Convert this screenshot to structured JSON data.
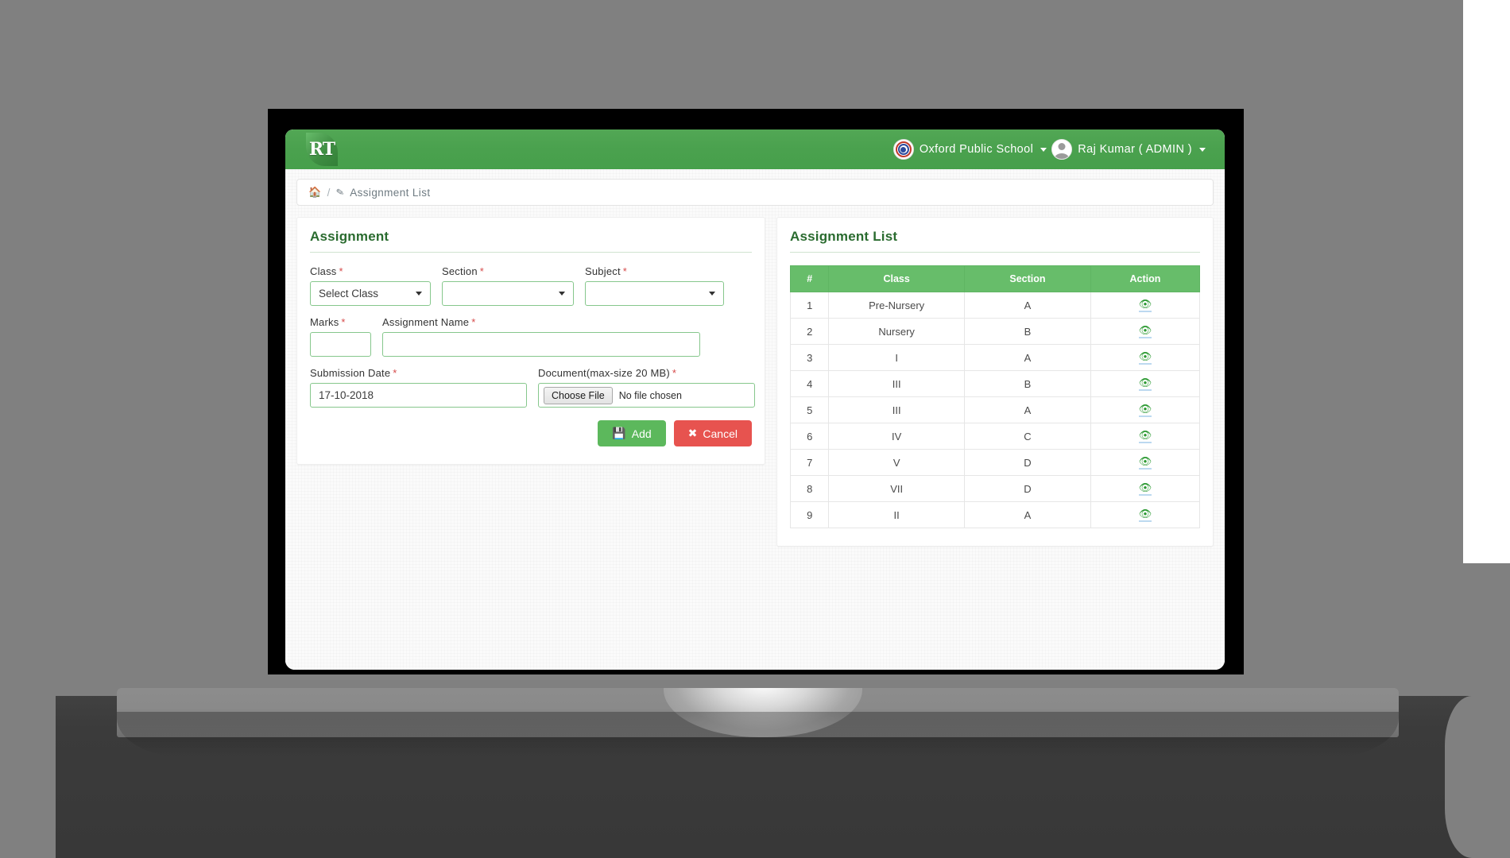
{
  "topbar": {
    "logo_text": "RT",
    "logo_icon": "rt-logo-icon",
    "school_name": "Oxford Public School",
    "school_icon": "school-crest-icon",
    "user_name": "Raj Kumar ( ADMIN )",
    "user_icon": "avatar-icon",
    "caret_icon": "caret-down-icon"
  },
  "breadcrumb": {
    "home_icon": "home-icon",
    "separator": "/",
    "pencil_icon": "pencil-icon",
    "current": "Assignment List"
  },
  "form": {
    "title": "Assignment",
    "required_mark": "*",
    "fields": {
      "class": {
        "label": "Class",
        "value": "Select Class",
        "placeholder": "Select Class"
      },
      "section": {
        "label": "Section",
        "value": "",
        "placeholder": ""
      },
      "subject": {
        "label": "Subject",
        "value": "",
        "placeholder": ""
      },
      "marks": {
        "label": "Marks",
        "value": "",
        "placeholder": ""
      },
      "assignment_name": {
        "label": "Assignment Name",
        "value": "",
        "placeholder": ""
      },
      "submission_date": {
        "label": "Submission Date",
        "value": "17-10-2018",
        "placeholder": ""
      },
      "document": {
        "label": "Document(max-size 20 MB)",
        "choose_button": "Choose File",
        "file_status": "No file chosen"
      }
    },
    "buttons": {
      "add": {
        "label": "Add",
        "icon": "save-icon",
        "color": "#5cb85c"
      },
      "cancel": {
        "label": "Cancel",
        "icon": "close-x-icon",
        "color": "#e7534f"
      }
    }
  },
  "list": {
    "title": "Assignment List",
    "columns": [
      "#",
      "Class",
      "Section",
      "Action"
    ],
    "action_icon": "eye-icon",
    "rows": [
      {
        "num": "1",
        "class": "Pre-Nursery",
        "section": "A"
      },
      {
        "num": "2",
        "class": "Nursery",
        "section": "B"
      },
      {
        "num": "3",
        "class": "I",
        "section": "A"
      },
      {
        "num": "4",
        "class": "III",
        "section": "B"
      },
      {
        "num": "5",
        "class": "III",
        "section": "A"
      },
      {
        "num": "6",
        "class": "IV",
        "section": "C"
      },
      {
        "num": "7",
        "class": "V",
        "section": "D"
      },
      {
        "num": "8",
        "class": "VII",
        "section": "D"
      },
      {
        "num": "9",
        "class": "II",
        "section": "A"
      }
    ]
  },
  "colors": {
    "brand_green": "#4aa14e",
    "header_green": "#67bd6a",
    "title_green": "#2a6b2f",
    "danger_red": "#e7534f",
    "required_red": "#d64b4b",
    "page_background": "#808080"
  }
}
